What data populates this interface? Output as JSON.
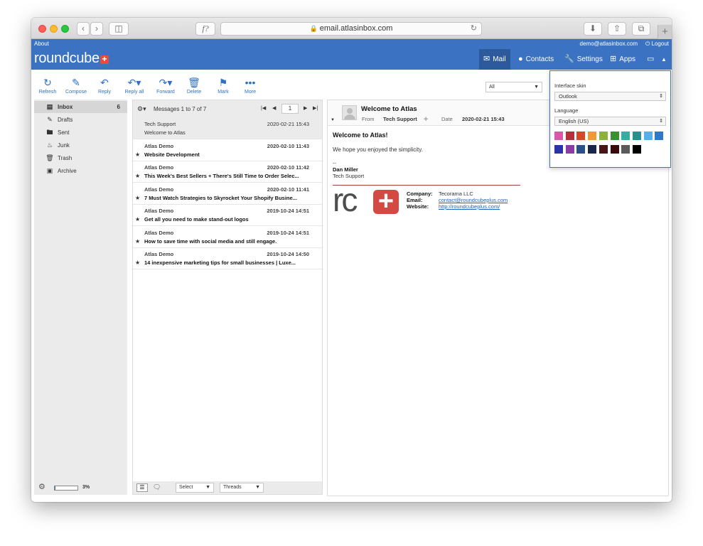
{
  "browser": {
    "url": "email.atlasinbox.com",
    "reader_glyph": "f?",
    "new_tab": "+"
  },
  "topline": {
    "about": "About",
    "user": "demo@atlasinbox.com",
    "logout": "Logout"
  },
  "brand": {
    "name": "roundcube",
    "plus": "+"
  },
  "nav": {
    "mail": "Mail",
    "contacts": "Contacts",
    "settings": "Settings",
    "apps": "Apps"
  },
  "toolbar": {
    "refresh": "Refresh",
    "compose": "Compose",
    "reply": "Reply",
    "reply_all": "Reply all",
    "forward": "Forward",
    "delete": "Delete",
    "mark": "Mark",
    "more": "More",
    "filter": "All"
  },
  "folders": [
    {
      "name": "Inbox",
      "count": "6",
      "icon": "inbox-icon"
    },
    {
      "name": "Drafts",
      "count": "",
      "icon": "pencil-icon"
    },
    {
      "name": "Sent",
      "count": "",
      "icon": "folder-icon"
    },
    {
      "name": "Junk",
      "count": "",
      "icon": "fire-icon"
    },
    {
      "name": "Trash",
      "count": "",
      "icon": "trash-icon"
    },
    {
      "name": "Archive",
      "count": "",
      "icon": "archive-icon"
    }
  ],
  "quota": {
    "percent": "3%",
    "fill": 3
  },
  "list": {
    "count": "Messages 1 to 7 of 7",
    "page": "1",
    "select": "Select",
    "threads": "Threads",
    "messages": [
      {
        "from": "Tech Support",
        "date": "2020-02-21 15:43",
        "subject": "Welcome to Atlas",
        "unread": false,
        "selected": true
      },
      {
        "from": "Atlas Demo",
        "date": "2020-02-10 11:43",
        "subject": "Website Development",
        "unread": true,
        "selected": false
      },
      {
        "from": "Atlas Demo",
        "date": "2020-02-10 11:42",
        "subject": "This Week's Best Sellers + There's Still Time to Order Selec...",
        "unread": true,
        "selected": false
      },
      {
        "from": "Atlas Demo",
        "date": "2020-02-10 11:41",
        "subject": "7 Must Watch Strategies to Skyrocket Your Shopify Busine...",
        "unread": true,
        "selected": false
      },
      {
        "from": "Atlas Demo",
        "date": "2019-10-24 14:51",
        "subject": "Get all you need to make stand-out logos",
        "unread": true,
        "selected": false
      },
      {
        "from": "Atlas Demo",
        "date": "2019-10-24 14:51",
        "subject": "How to save time with social media and still engage.",
        "unread": true,
        "selected": false
      },
      {
        "from": "Atlas Demo",
        "date": "2019-10-24 14:50",
        "subject": "14 inexpensive marketing tips for small businesses | Luxe...",
        "unread": true,
        "selected": false
      }
    ]
  },
  "preview": {
    "title": "Welcome to Atlas",
    "from_label": "From",
    "from": "Tech Support",
    "date_label": "Date",
    "date": "2020-02-21 15:43",
    "heading": "Welcome to Atlas!",
    "paragraph": "We hope you enjoyed the simplicity.",
    "sig_dash": "--",
    "sig_name": "Dan Miller",
    "sig_role": "Tech Support",
    "logo_letters": "rc",
    "logo_plus": "+",
    "company_label": "Company:",
    "company": "Tecorama LLC",
    "email_label": "Email:",
    "email": "contact@roundcubeplus.com",
    "website_label": "Website:",
    "website": "http://roundcubeplus.com/"
  },
  "skin_popup": {
    "skin_label": "Interface skin",
    "skin_value": "Outlook",
    "language_label": "Language",
    "language_value": "English (US)",
    "colors_row1": [
      "#d75aa8",
      "#b0323b",
      "#d24a2a",
      "#ef9a3a",
      "#8db23c",
      "#3a8f2e",
      "#3aaba4",
      "#2b8f8b",
      "#5aaee8",
      "#2e78c7"
    ],
    "colors_row2": [
      "#2c33a8",
      "#8c3ca6",
      "#2a4f8a",
      "#1b2748",
      "#4a1414",
      "#3b0a0a",
      "#5a5a5a",
      "#000000"
    ]
  },
  "colors": {
    "brand_blue": "#3b73c2",
    "accent_blue": "#2f70c0"
  }
}
